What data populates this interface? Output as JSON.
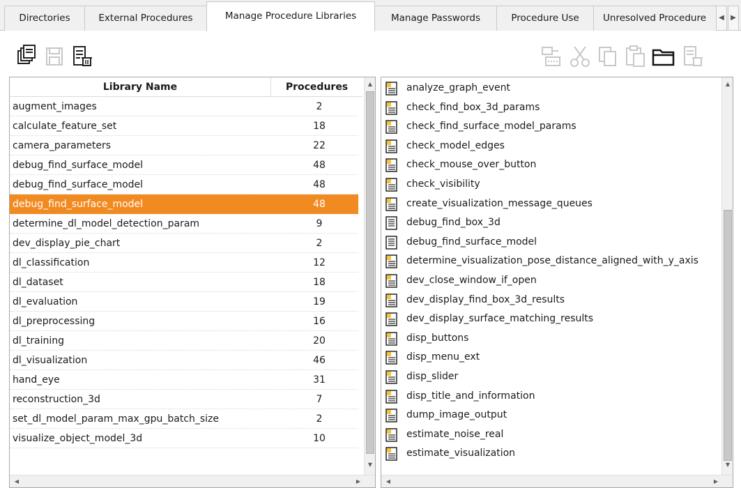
{
  "tabs": [
    {
      "label": "Directories",
      "active": false
    },
    {
      "label": "External Procedures",
      "active": false
    },
    {
      "label": "Manage Procedure Libraries",
      "active": true
    },
    {
      "label": "Manage Passwords",
      "active": false
    },
    {
      "label": "Procedure Use",
      "active": false
    },
    {
      "label": "Unresolved Procedure",
      "active": false
    }
  ],
  "toolbar_left": [
    "open-library-icon",
    "save-icon",
    "delete-library-icon"
  ],
  "toolbar_right": [
    "insert-icon",
    "cut-icon",
    "copy-icon",
    "paste-icon",
    "open-folder-icon",
    "delete-procedure-icon"
  ],
  "libraries": {
    "header": {
      "name": "Library Name",
      "count": "Procedures"
    },
    "rows": [
      {
        "name": "augment_images",
        "count": "2"
      },
      {
        "name": "calculate_feature_set",
        "count": "18"
      },
      {
        "name": "camera_parameters",
        "count": "22"
      },
      {
        "name": "debug_find_surface_model",
        "count": "48"
      },
      {
        "name": "debug_find_surface_model",
        "count": "48"
      },
      {
        "name": "debug_find_surface_model",
        "count": "48"
      },
      {
        "name": "determine_dl_model_detection_param",
        "count": "9"
      },
      {
        "name": "dev_display_pie_chart",
        "count": "2"
      },
      {
        "name": "dl_classification",
        "count": "12"
      },
      {
        "name": "dl_dataset",
        "count": "18"
      },
      {
        "name": "dl_evaluation",
        "count": "19"
      },
      {
        "name": "dl_preprocessing",
        "count": "16"
      },
      {
        "name": "dl_training",
        "count": "20"
      },
      {
        "name": "dl_visualization",
        "count": "46"
      },
      {
        "name": "hand_eye",
        "count": "31"
      },
      {
        "name": "reconstruction_3d",
        "count": "7"
      },
      {
        "name": "set_dl_model_param_max_gpu_batch_size",
        "count": "2"
      },
      {
        "name": "visualize_object_model_3d",
        "count": "10"
      }
    ],
    "selected_index": 5
  },
  "procedures": [
    "analyze_graph_event",
    "check_find_box_3d_params",
    "check_find_surface_model_params",
    "check_model_edges",
    "check_mouse_over_button",
    "check_visibility",
    "create_visualization_message_queues",
    "debug_find_box_3d",
    "debug_find_surface_model",
    "determine_visualization_pose_distance_aligned_with_y_axis",
    "dev_close_window_if_open",
    "dev_display_find_box_3d_results",
    "dev_display_surface_matching_results",
    "disp_buttons",
    "disp_menu_ext",
    "disp_slider",
    "disp_title_and_information",
    "dump_image_output",
    "estimate_noise_real",
    "estimate_visualization"
  ],
  "procedure_icons": [
    "doc-icon",
    "doc-icon",
    "doc-icon",
    "doc-icon",
    "doc-icon",
    "doc-icon",
    "doc-icon",
    "list-icon",
    "list-icon",
    "doc-icon",
    "doc-icon",
    "doc-icon",
    "doc-icon",
    "doc-icon",
    "doc-icon",
    "doc-icon",
    "doc-icon",
    "doc-icon",
    "doc-icon",
    "doc-icon"
  ],
  "colors": {
    "selection": "#f28a22",
    "tab_bg": "#f0f0f0",
    "icon_yellow": "#f6c33a"
  }
}
